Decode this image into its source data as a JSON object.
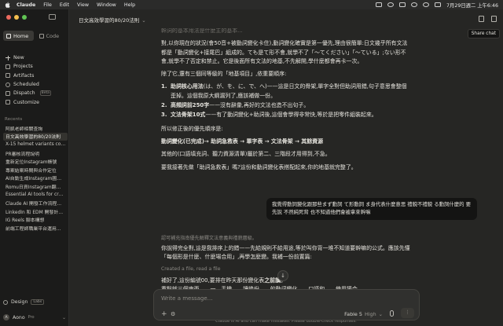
{
  "menubar": {
    "app": "Claude",
    "items": [
      "File",
      "Edit",
      "View",
      "Window",
      "Help"
    ],
    "clock": "7月29日週二 上午6:46"
  },
  "sidebar": {
    "tabs": [
      {
        "label": "Home"
      },
      {
        "label": "Code"
      }
    ],
    "nav": [
      {
        "label": "New",
        "icon": "plus-icon"
      },
      {
        "label": "Projects",
        "icon": "folder-icon"
      },
      {
        "label": "Artifacts",
        "icon": "artifact-icon"
      },
      {
        "label": "Scheduled",
        "icon": "clock-icon"
      },
      {
        "label": "Dispatch",
        "icon": "dispatch-icon",
        "badge": "Beta"
      },
      {
        "label": "Customize",
        "icon": "sliders-icon"
      }
    ],
    "recents_heading": "Recents",
    "recents": [
      "阿凱老師相關查詢",
      "日文高效學習的80/20法則",
      "X-15 helmet variants co…",
      "PR審核流程說明",
      "重新定位Instagram帳號",
      "專案結案時間與合作定位",
      "AI自動生成Instagram圖…",
      "Romu日資Instagram翻…",
      "Essential AI tools for cr…",
      "Claude AI 開發工作流程…",
      "LinkedIn 和 EDM 開發計…",
      "IG Reels 腳本構想",
      "前端工程師職業平台運用…"
    ],
    "active_recent_index": 1,
    "design": {
      "label": "Design",
      "badge": "Labs"
    },
    "user": {
      "initial": "A",
      "name": "Aono",
      "plan": "Pro"
    }
  },
  "header": {
    "title": "日文高效學習的80/20法則",
    "tooltip": "Share chat"
  },
  "conversation": {
    "faded_top": "幹詞的基本用法是什麼主的基本...",
    "p1": "對,以你現在的狀況(會50音+被動詞變化卡住),動詞變化確實是第一優先,理由很簡單:日文幾乎所有文法都是「動詞變化+接尾巴」組成的。ても是て形不會,就學不了「〜てください」「〜ている」;ない形不會,就學不了否定和禁止。它是後面所有文法的地基,不先解開,學什麼都會再卡一次。",
    "p2": "除了它,還有三個同等級的「地基項目」,依重要順序:",
    "list": [
      {
        "num": "1.",
        "bold": "助詞核心用法",
        "rest": "(は、が、を、に、で、へ)——這是日文的骨架,單字全對但助詞用錯,句子意思會整個歪掉。這個我原大綱漏列了,應該補做一份。"
      },
      {
        "num": "2.",
        "bold": "高頻詞前250字",
        "rest": "——沒有辭彙,再好的文法也造不出句子。"
      },
      {
        "num": "3.",
        "bold": "文法骨架10式",
        "rest": "——有了動詞變化+助詞後,這個會學得非常快,等於是把零件組裝起來。"
      }
    ],
    "p3": "所以修正後的優先順序是:",
    "priority": "動詞變化(已完成)→ 助詞急救表 → 單字表 → 文法骨架 → 其餘資源",
    "p4": "其他的(口語填充詞、聽力資源清單)屬於第二、三階段才用得到,不急。",
    "p5": "要我接著先做「助詞急救表」嗎?這份和動詞變化表搭配起來,你的地基就完整了。",
    "user_message": "我覺得動詞變化跟那些まず動詞 て形動詞 ま身代表什麼意思 禮貌不禮貌 る動詞什麼的 要先說 不然純死背 也不知道他們會被拿來幹嘛",
    "thinking": "認可補充指南優先解釋文法意義與禮貌層級。",
    "p6": "你說得完全對,這是我排序上的錯——先給規則不給用途,等於叫你背一堆不知道要幹嘛的公式。應該先懂「每個形是什麼、什麼場合用」,再學怎麼變。我補一份前置篇:",
    "tool_line": "Created a file, read a file",
    "p7_prefix": "補好了,這份編號00,要排在昨天那份變化表",
    "p7_bold": "之前讀",
    "p7_suffix": "。",
    "p8": "重點就三個東西……一、手機……讀幾份……的動詞變化……口語和……使用場合…"
  },
  "composer": {
    "placeholder": "Write a message…",
    "model": "Fable 5",
    "effort": "High",
    "disclaimer": "Claude is AI and can make mistakes. Please double-check responses."
  },
  "colors": {
    "bg_main": "#262624",
    "bg_sidebar": "#1b1b1a",
    "text": "#e6e4de",
    "muted": "#85837d",
    "traffic_red": "#ec6a5e",
    "traffic_yellow": "#f4bf4f",
    "traffic_green": "#61c554"
  }
}
